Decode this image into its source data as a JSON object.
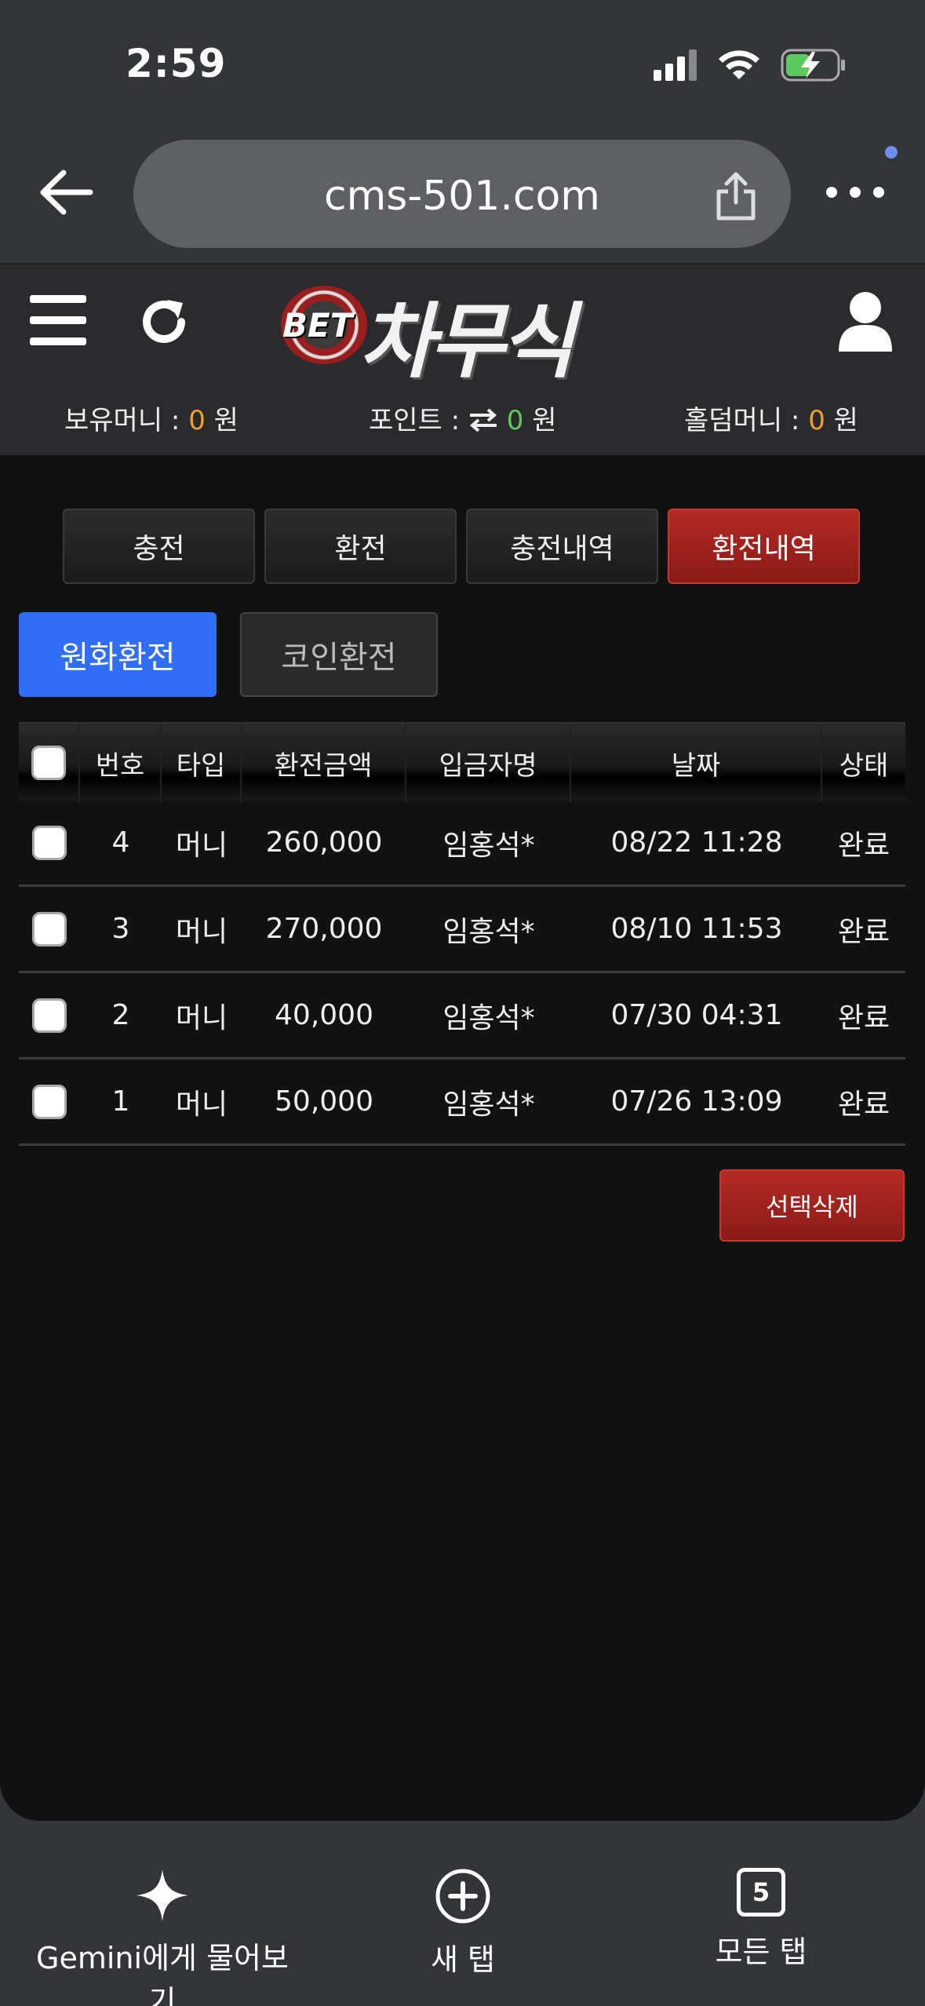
{
  "status_bar": {
    "time": "2:59"
  },
  "browser": {
    "url": "cms-501.com",
    "icons": [
      "back-arrow-icon",
      "share-icon",
      "more-dots-icon"
    ]
  },
  "site_header": {
    "logo_badge": "BET",
    "logo_text": "차무식",
    "balances": {
      "money_label": "보유머니 :",
      "money_value": "0",
      "money_unit": "원",
      "point_label": "포인트 :",
      "point_value": "0",
      "point_unit": "원",
      "holdem_label": "홀덤머니 :",
      "holdem_value": "0",
      "holdem_unit": "원"
    }
  },
  "tabs": [
    "충전",
    "환전",
    "충전내역",
    "환전내역"
  ],
  "active_tab": "환전내역",
  "subtabs": [
    "원화환전",
    "코인환전"
  ],
  "table": {
    "headers": [
      "번호",
      "타입",
      "환전금액",
      "입금자명",
      "날짜",
      "상태"
    ],
    "rows": [
      {
        "no": "4",
        "type": "머니",
        "amount": "260,000",
        "name": "임홍석*",
        "date": "08/22 11:28",
        "status": "완료"
      },
      {
        "no": "3",
        "type": "머니",
        "amount": "270,000",
        "name": "임홍석*",
        "date": "08/10 11:53",
        "status": "완료"
      },
      {
        "no": "2",
        "type": "머니",
        "amount": "40,000",
        "name": "임홍석*",
        "date": "07/30 04:31",
        "status": "완료"
      },
      {
        "no": "1",
        "type": "머니",
        "amount": "50,000",
        "name": "임홍석*",
        "date": "07/26 13:09",
        "status": "완료"
      }
    ]
  },
  "delete_button": "선택삭제",
  "toolbar": {
    "gemini": "Gemini에게 물어보기",
    "new_tab": "새 탭",
    "all_tabs": "모든 탭",
    "tab_count": "5"
  },
  "colors": {
    "accent_red": "#b52a24",
    "accent_blue": "#2f6ef5",
    "value_orange": "#f0a030",
    "value_green": "#5ec95e"
  }
}
